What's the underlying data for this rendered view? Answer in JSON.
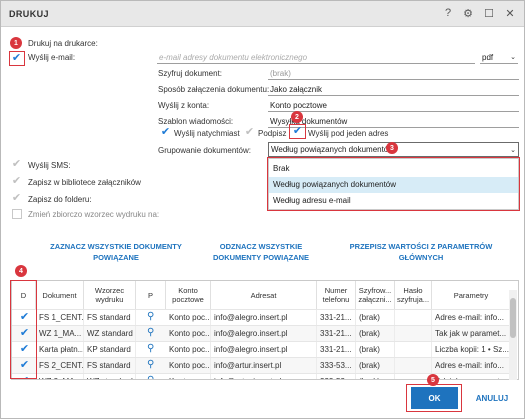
{
  "window": {
    "title": "DRUKUJ"
  },
  "titlebar_icons": [
    "help-icon",
    "gear-icon",
    "maximize-icon",
    "close-icon"
  ],
  "titlebar_glyphs": {
    "help": "?",
    "gear": "⚙",
    "maximize": "☐",
    "close": "✕"
  },
  "print_to_printer": {
    "label": "Drukuj na drukarce:"
  },
  "send_email": {
    "label": "Wyślij e-mail:",
    "checked": true,
    "placeholder": "e-mail adresy dokumentu elektronicznego",
    "format": "pdf"
  },
  "email_options": {
    "encrypt": {
      "label": "Szyfruj dokument:",
      "value": "(brak)"
    },
    "attach_method": {
      "label": "Sposób załączenia dokumentu:",
      "value": "Jako załącznik"
    },
    "from_account": {
      "label": "Wyślij z konta:",
      "value": "Konto pocztowe"
    },
    "template": {
      "label": "Szablon wiadomości:",
      "value": "Wysyłka dokumentów"
    }
  },
  "send_options": {
    "send_now": {
      "label": "Wyślij natychmiast",
      "checked": true
    },
    "signature": {
      "label": "Podpisz",
      "checked": true
    },
    "single_address": {
      "label": "Wyślij pod jeden adres",
      "checked": true
    }
  },
  "grouping": {
    "label": "Grupowanie dokumentów:",
    "value": "Według powiązanych dokumentów",
    "options": [
      "Brak",
      "Według powiązanych dokumentów",
      "Według adresu e-mail"
    ],
    "selected_index": 1
  },
  "other_options": {
    "sms": {
      "label": "Wyślij SMS:"
    },
    "library": {
      "label": "Zapisz w bibliotece załączników"
    },
    "folder": {
      "label": "Zapisz do folderu:"
    },
    "change_template": {
      "label": "Zmień zbiorczo wzorzec wydruku na:"
    }
  },
  "actions": {
    "select_all_related": "ZAZNACZ WSZYSTKIE DOKUMENTY POWIĄZANE",
    "deselect_all_related": "ODZNACZ WSZYSTKIE DOKUMENTY POWIĄZANE",
    "copy_params": "PRZEPISZ WARTOŚCI Z PARAMETRÓW GŁÓWNYCH"
  },
  "table": {
    "headers": [
      "D",
      "Dokument",
      "Wzorzec wydruku",
      "P",
      "Konto pocztowe",
      "Adresat",
      "Numer telefonu",
      "Szyfrow... załączni...",
      "Hasło szyfruja...",
      "Parametry"
    ],
    "rows": [
      [
        "FS 1_CENT...",
        "FS standard",
        "Konto poc...",
        "info@alegro.insert.pl",
        "331-21...",
        "(brak)",
        "",
        "Adres e-mail: info..."
      ],
      [
        "WZ 1_MA...",
        "WZ standard",
        "Konto poc...",
        "info@alegro.insert.pl",
        "331-21...",
        "(brak)",
        "",
        "Tak jak w paramet..."
      ],
      [
        "Karta płatn...",
        "KP standard",
        "Konto poc...",
        "info@alegro.insert.pl",
        "331-21...",
        "(brak)",
        "",
        "Liczba kopii: 1 • Sz..."
      ],
      [
        "FS 2_CENT...",
        "FS standard",
        "Konto poc...",
        "info@artur.insert.pl",
        "333-53...",
        "(brak)",
        "",
        "Adres e-mail: info..."
      ],
      [
        "WZ 2_MA...",
        "WZ standard",
        "Konto poc...",
        "info@artur.insert.pl",
        "333-53...",
        "(brak)",
        "",
        "Tak jak w paramet..."
      ]
    ]
  },
  "buttons": {
    "ok": "OK",
    "cancel": "ANULUJ"
  },
  "badges": [
    "1",
    "2",
    "3",
    "4",
    "5"
  ],
  "colors": {
    "accent": "#1e73be",
    "highlight": "#d9363e",
    "selected_row": "#d7ecf7"
  }
}
